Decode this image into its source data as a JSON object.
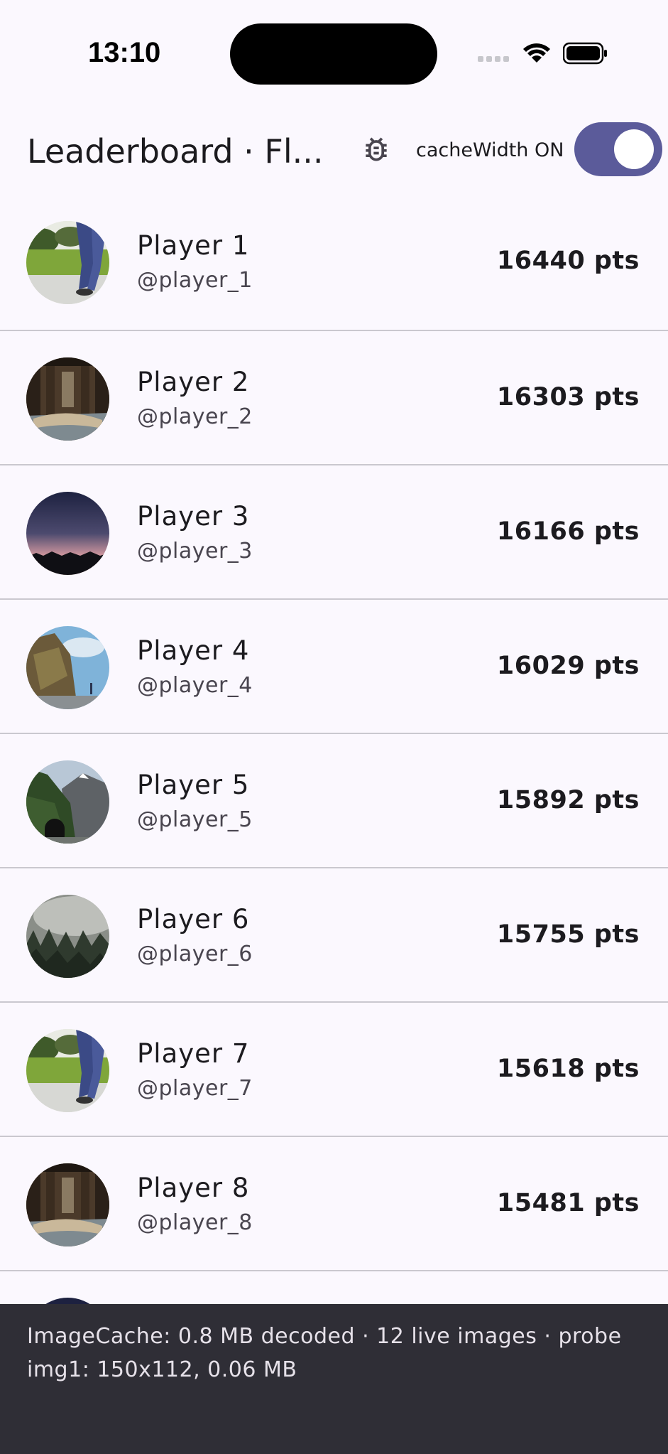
{
  "status": {
    "time": "13:10"
  },
  "app_bar": {
    "title": "Leaderboard · Fl...",
    "bug_icon": "bug-icon",
    "toggle_label": "cacheWidth ON",
    "toggle_on": true
  },
  "players": [
    {
      "name": "Player 1",
      "handle": "@player_1",
      "score": "16440 pts",
      "image": "park-legs"
    },
    {
      "name": "Player 2",
      "handle": "@player_2",
      "score": "16303 pts",
      "image": "pier"
    },
    {
      "name": "Player 3",
      "handle": "@player_3",
      "score": "16166 pts",
      "image": "dusk-sky"
    },
    {
      "name": "Player 4",
      "handle": "@player_4",
      "score": "16029 pts",
      "image": "cliff-coast"
    },
    {
      "name": "Player 5",
      "handle": "@player_5",
      "score": "15892 pts",
      "image": "mountain-tunnel"
    },
    {
      "name": "Player 6",
      "handle": "@player_6",
      "score": "15755 pts",
      "image": "foggy-forest"
    },
    {
      "name": "Player 7",
      "handle": "@player_7",
      "score": "15618 pts",
      "image": "park-legs"
    },
    {
      "name": "Player 8",
      "handle": "@player_8",
      "score": "15481 pts",
      "image": "pier"
    }
  ],
  "debug": {
    "line1": "ImageCache: 0.8 MB decoded · 12 live images · probe",
    "line2": "img1: 150x112, 0.06 MB"
  },
  "colors": {
    "background": "#fbf8fe",
    "switch_track": "#5b5b9a",
    "debug_panel": "#2f2e36",
    "divider": "#cac8cf"
  }
}
